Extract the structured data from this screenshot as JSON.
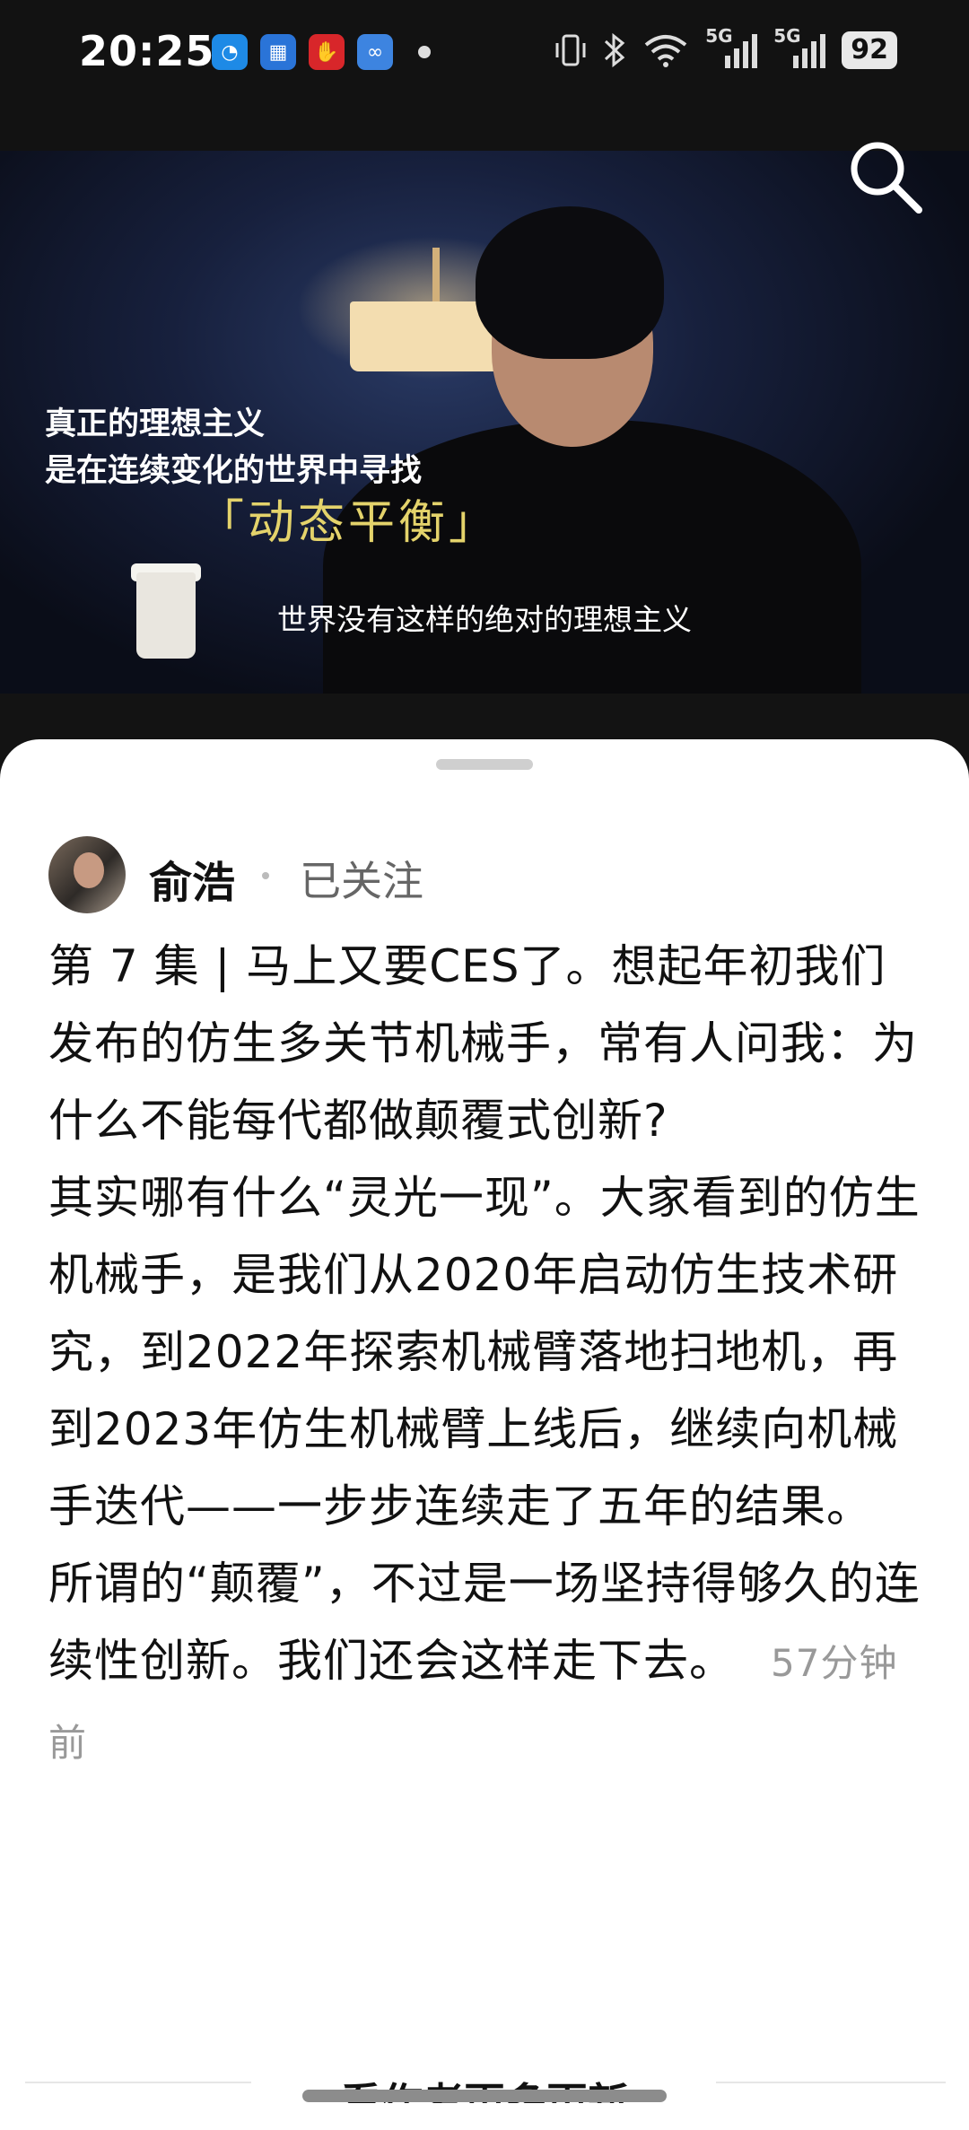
{
  "status_bar": {
    "time": "20:25",
    "app_icons": [
      {
        "name": "browser-app-icon",
        "color": "#1e8ae6",
        "glyph": "◔"
      },
      {
        "name": "chart-app-icon",
        "color": "#2a74d8",
        "glyph": "▦"
      },
      {
        "name": "thumbs-app-icon",
        "color": "#d8262a",
        "glyph": "👍"
      },
      {
        "name": "swirl-app-icon",
        "color": "#3d84e0",
        "glyph": "∞"
      }
    ],
    "network_1": "5G",
    "network_2": "5G",
    "battery": "92"
  },
  "video": {
    "overlay_line1": "真正的理想主义",
    "overlay_line2": "是在连续变化的世界中寻找",
    "overlay_emphasis": "「动态平衡」",
    "subtitle": "世界没有这样的绝对的理想主义"
  },
  "post": {
    "author": "俞浩",
    "follow_status": "已关注",
    "paragraphs": [
      "第 7 集 | 马上又要CES了。想起年初我们发布的仿生多关节机械手，常有人问我：为什么不能每代都做颠覆式创新?",
      "其实哪有什么“灵光一现”。大家看到的仿生机械手，是我们从2020年启动仿生技术研究，到2022年探索机械臂落地扫地机，再到2023年仿生机械臂上线后，继续向机械手迭代——一步步连续走了五年的结果。",
      "所谓的“颠覆”，不过是一场坚持得够久的连续性创新。我们还会这样走下去。"
    ],
    "time_ago": "57分钟前"
  },
  "more_updates_label": "看作者更多更新",
  "colors": {
    "sheet_bg": "#ffffff",
    "text": "#111111",
    "muted": "#999999",
    "overlay_accent": "#e4d36b"
  }
}
